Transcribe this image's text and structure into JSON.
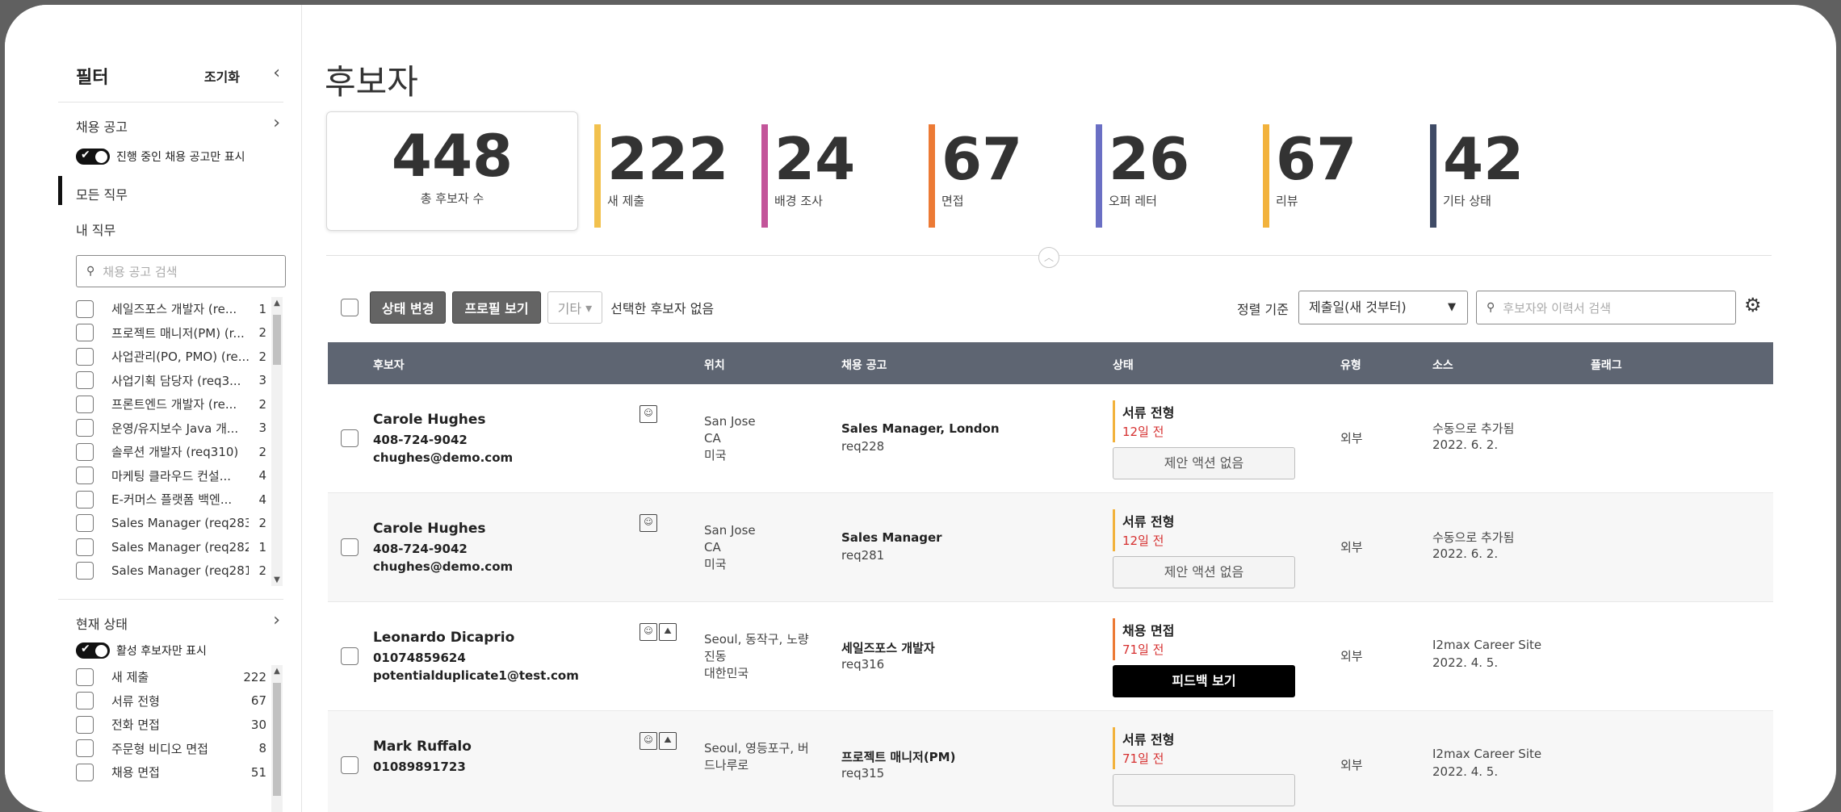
{
  "sidebar": {
    "title": "필터",
    "reset": "조기화",
    "jobs_section": "채용 공고",
    "active_jobs_toggle": "진행 중인 채용 공고만 표시",
    "nav": [
      "모든 직무",
      "내 직무"
    ],
    "job_search_placeholder": "채용 공고 검색",
    "jobs": [
      {
        "label": "세일즈포스 개발자 (re...",
        "count": "1"
      },
      {
        "label": "프로젝트 매니저(PM) (r...",
        "count": "2"
      },
      {
        "label": "사업관리(PO, PMO) (re...",
        "count": "2"
      },
      {
        "label": "사업기획 담당자 (req3...",
        "count": "3"
      },
      {
        "label": "프론트엔드 개발자 (re...",
        "count": "2"
      },
      {
        "label": "운영/유지보수 Java 개...",
        "count": "3"
      },
      {
        "label": "솔루션 개발자 (req310)",
        "count": "2"
      },
      {
        "label": "마케팅 클라우드 컨설...",
        "count": "4"
      },
      {
        "label": "E-커머스 플랫폼 백엔...",
        "count": "4"
      },
      {
        "label": "Sales Manager (req283)",
        "count": "2"
      },
      {
        "label": "Sales Manager (req282)",
        "count": "1"
      },
      {
        "label": "Sales Manager (req281)",
        "count": "2"
      }
    ],
    "status_section": "현재 상태",
    "active_candidates_toggle": "활성 후보자만 표시",
    "statuses": [
      {
        "label": "새 제출",
        "count": "222"
      },
      {
        "label": "서류 전형",
        "count": "67"
      },
      {
        "label": "전화 면접",
        "count": "30"
      },
      {
        "label": "주문형 비디오 면접",
        "count": "8"
      },
      {
        "label": "채용 면접",
        "count": "51"
      }
    ]
  },
  "page_title": "후보자",
  "summary": {
    "total": {
      "value": "448",
      "label": "총 후보자 수"
    },
    "stats": [
      {
        "value": "222",
        "label": "새 제출",
        "color": "#f2c14e"
      },
      {
        "value": "24",
        "label": "배경 조사",
        "color": "#c3559a"
      },
      {
        "value": "67",
        "label": "면접",
        "color": "#ec7a35"
      },
      {
        "value": "26",
        "label": "오퍼 레터",
        "color": "#6a6fc4"
      },
      {
        "value": "67",
        "label": "리뷰",
        "color": "#f2b23c"
      },
      {
        "value": "42",
        "label": "기타 상태",
        "color": "#3f4b66"
      }
    ]
  },
  "toolbar": {
    "change_status": "상태 변경",
    "view_profile": "프로필 보기",
    "more": "기타",
    "selection_text": "선택한 후보자 없음",
    "sort_label": "정렬 기준",
    "sort_value": "제출일(새 것부터)",
    "search_placeholder": "후보자와 이력서 검색"
  },
  "table": {
    "headers": [
      "후보자",
      "위치",
      "채용 공고",
      "상태",
      "유형",
      "소스",
      "플래그"
    ],
    "rows": [
      {
        "name": "Carole Hughes",
        "phone": "408-724-9042",
        "email": "chughes@demo.com",
        "loc1": "San Jose",
        "loc2": "CA",
        "loc3": "미국",
        "job": "Sales Manager, London",
        "req": "req228",
        "stage": "서류 전형",
        "age": "12일 전",
        "action": "제안 액션 없음",
        "type": "외부",
        "source": "수동으로 추가됨",
        "date": "2022. 6. 2.",
        "stage_color": "#f2b23c",
        "icons": [
          "resume-icon"
        ]
      },
      {
        "name": "Carole Hughes",
        "phone": "408-724-9042",
        "email": "chughes@demo.com",
        "loc1": "San Jose",
        "loc2": "CA",
        "loc3": "미국",
        "job": "Sales Manager",
        "req": "req281",
        "stage": "서류 전형",
        "age": "12일 전",
        "action": "제안 액션 없음",
        "type": "외부",
        "source": "수동으로 추가됨",
        "date": "2022. 6. 2.",
        "stage_color": "#f2b23c",
        "icons": [
          "resume-icon"
        ]
      },
      {
        "name": "Leonardo Dicaprio",
        "phone": "01074859624",
        "email": "potentialduplicate1@test.com",
        "loc1": "Seoul, 동작구, 노량",
        "loc2": "진동",
        "loc3": "대한민국",
        "job": "세일즈포스 개발자",
        "req": "req316",
        "stage": "채용 면접",
        "age": "71일 전",
        "action": "피드백 보기",
        "type": "외부",
        "source": "I2max Career Site",
        "date": "2022. 4. 5.",
        "stage_color": "#ec7a35",
        "icons": [
          "resume-icon",
          "attachment-icon"
        ]
      },
      {
        "name": "Mark Ruffalo",
        "phone": "01089891723",
        "email": "",
        "loc1": "Seoul, 영등포구, 버",
        "loc2": "드나루로",
        "loc3": "",
        "job": "프로젝트 매니저(PM)",
        "req": "req315",
        "stage": "서류 전형",
        "age": "71일 전",
        "action": "",
        "type": "외부",
        "source": "I2max Career Site",
        "date": "2022. 4. 5.",
        "stage_color": "#f2b23c",
        "icons": [
          "resume-icon",
          "attachment-icon"
        ]
      }
    ]
  }
}
